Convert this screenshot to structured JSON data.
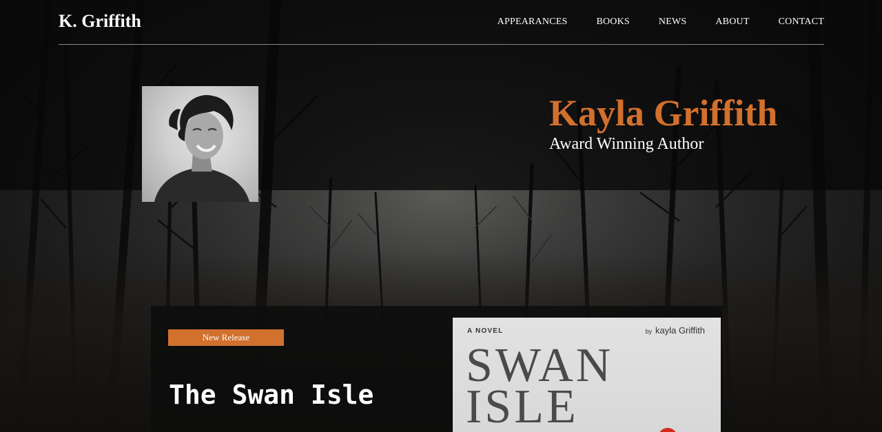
{
  "site": {
    "logo": "K. Griffith"
  },
  "nav": {
    "items": [
      "APPEARANCES",
      "BOOKS",
      "NEWS",
      "ABOUT",
      "CONTACT"
    ]
  },
  "hero": {
    "name": "Kayla Griffith",
    "tagline": "Award Winning Author",
    "photo_icon": "author-portrait"
  },
  "feature": {
    "badge": "New Release",
    "title": "The Swan Isle",
    "cover": {
      "kicker": "A NOVEL",
      "by": "by",
      "author": "kayla Griffith",
      "title": "SWAN\nISLE"
    }
  },
  "colors": {
    "accent": "#d2702e",
    "text": "#ffffff",
    "header_rule": "#8a8a8a"
  }
}
